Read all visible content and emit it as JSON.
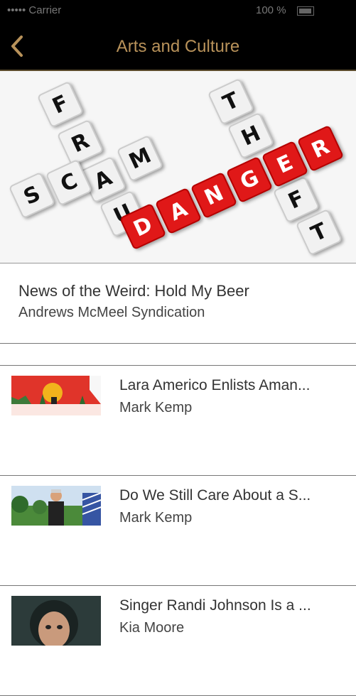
{
  "status_bar": {
    "carrier": "••••• Carrier",
    "battery": "100 %"
  },
  "header": {
    "title": "Arts and Culture"
  },
  "hero_tiles": [
    "F",
    "R",
    "A",
    "U",
    "D",
    "S",
    "C",
    "A",
    "M",
    "T",
    "H",
    "E",
    "F",
    "T",
    "D",
    "A",
    "N",
    "G",
    "E",
    "R"
  ],
  "featured": {
    "title": "News of the Weird: Hold My Beer",
    "source": "Andrews McMeel Syndication"
  },
  "articles": [
    {
      "title": "Lara Americo Enlists Aman...",
      "author": "Mark Kemp"
    },
    {
      "title": "Do We Still Care About a S...",
      "author": "Mark Kemp"
    },
    {
      "title": "Singer Randi Johnson Is a ...",
      "author": "Kia Moore"
    }
  ],
  "colors": {
    "bar": "#000000",
    "accent": "#b8925a",
    "danger_red": "#e01818"
  }
}
